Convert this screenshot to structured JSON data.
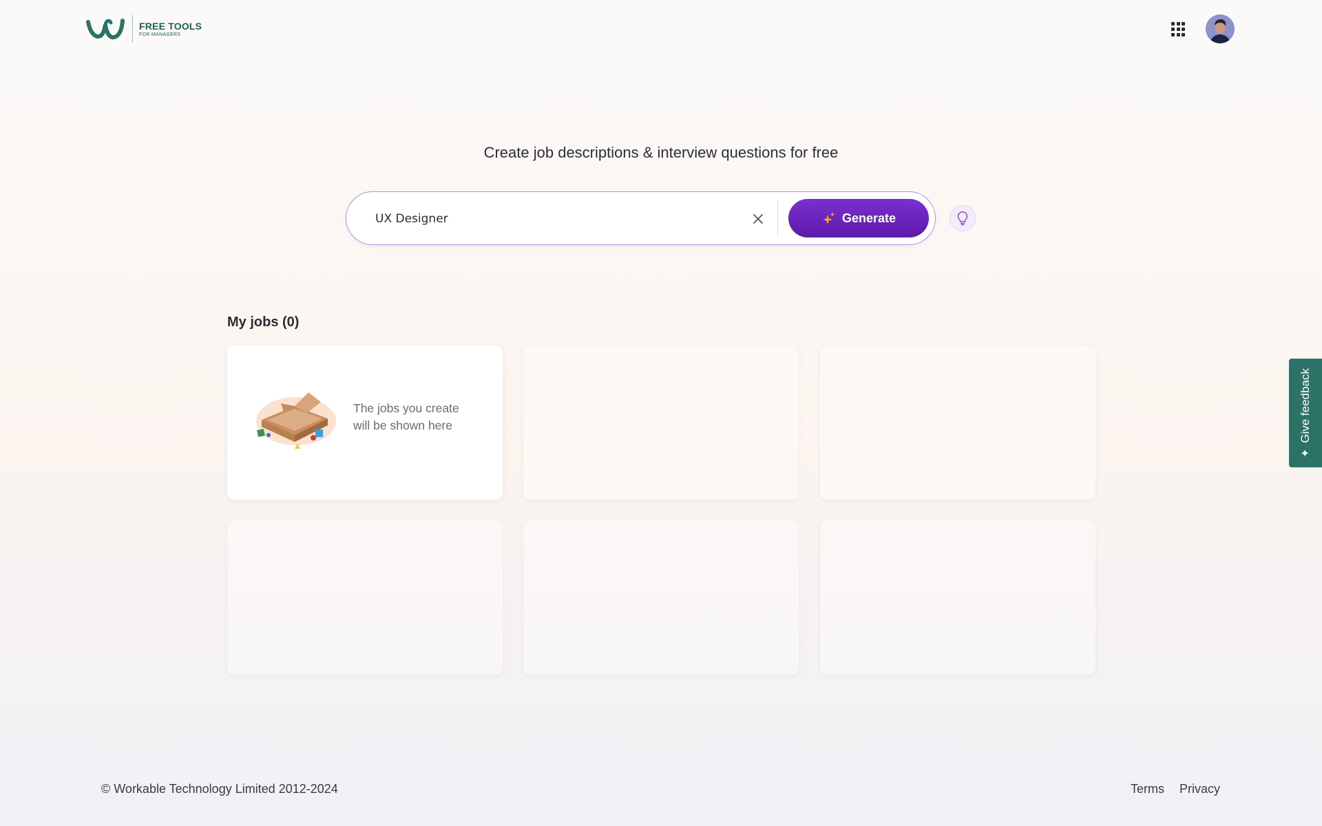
{
  "header": {
    "logo_title": "FREE TOOLS",
    "logo_subtitle": "FOR MANAGERS",
    "apps_icon": "grid-icon",
    "avatar_icon": "user-avatar"
  },
  "hero": {
    "title": "Create job descriptions & interview questions for free",
    "search_value": "UX Designer",
    "generate_label": "Generate",
    "clear_icon": "close-icon",
    "tip_icon": "lightbulb-icon"
  },
  "jobs": {
    "title": "My jobs (0)",
    "empty_text_line1": "The jobs you create",
    "empty_text_line2": "will be shown here"
  },
  "feedback": {
    "label": "Give feedback"
  },
  "footer": {
    "copyright": "© Workable Technology Limited 2012-2024",
    "terms": "Terms",
    "privacy": "Privacy"
  },
  "colors": {
    "brand_green": "#2c7266",
    "generate_purple": "#6a22bd",
    "search_border": "#b58de0"
  }
}
